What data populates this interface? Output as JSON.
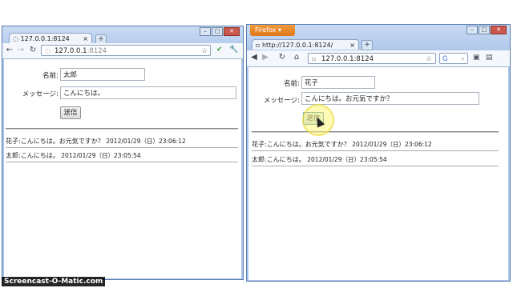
{
  "chrome": {
    "tab_title": "127.0.0.1:8124",
    "url_host": "127.0.0.1",
    "url_port": ":8124",
    "new_tab": "+",
    "form": {
      "name_label": "名前:",
      "name_value": "太郎",
      "message_label": "メッセージ:",
      "message_value": "こんにちは。",
      "submit_label": "送信"
    },
    "messages": [
      {
        "author": "花子",
        "text": "こんにちは。お元気ですか？",
        "timestamp": "2012/01/29（日）23:06:12"
      },
      {
        "author": "太郎",
        "text": "こんにちは。",
        "timestamp": "2012/01/29（日）23:05:54"
      }
    ]
  },
  "firefox": {
    "app_button": "Firefox ▾",
    "tab_title": "http://127.0.0.1:8124/",
    "url": "127.0.0.1:8124",
    "new_tab": "+",
    "form": {
      "name_label": "名前:",
      "name_value": "花子",
      "message_label": "メッセージ:",
      "message_value": "こんにちは。お元気ですか？",
      "submit_label": "送信"
    },
    "messages": [
      {
        "author": "花子",
        "text": "こんにちは。お元気ですか？",
        "timestamp": "2012/01/29（日）23:06:12"
      },
      {
        "author": "太郎",
        "text": "こんにちは。",
        "timestamp": "2012/01/29（日）23:05:54"
      }
    ]
  },
  "window_controls": {
    "minimize": "–",
    "maximize": "□",
    "close": "✕"
  },
  "watermark": "Screencast-O-Matic.com",
  "colors": {
    "firefox_orange": "#e0761b",
    "window_blue": "#a8c3e8",
    "highlight": "#fff578"
  }
}
